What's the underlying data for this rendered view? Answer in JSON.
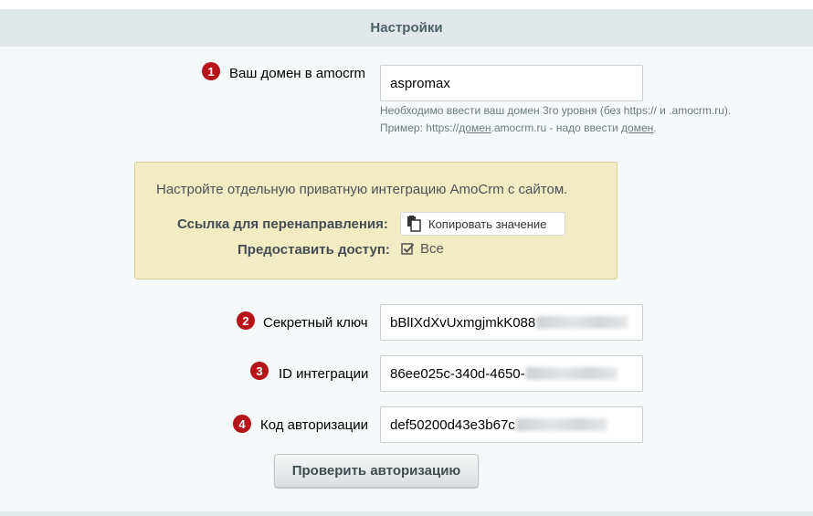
{
  "header": {
    "title": "Настройки"
  },
  "domain": {
    "badge": "1",
    "label": "Ваш домен в amocrm",
    "value": "aspromax",
    "hint_line1": "Необходимо ввести ваш домен 3го уровня (без https:// и .amocrm.ru).",
    "hint_line2_prefix": "Пример: https://",
    "hint_line2_domain": "домен",
    "hint_line2_middle": ".amocrm.ru - надо ввести ",
    "hint_line2_domain2": "домен",
    "hint_line2_suffix": "."
  },
  "notice": {
    "text": "Настройте отдельную приватную интеграцию AmoCrm с сайтом.",
    "redirect_label": "Ссылка для перенаправления:",
    "copy_button": "Копировать значение",
    "access_label": "Предоставить доступ:",
    "access_value": "Все"
  },
  "secret": {
    "badge": "2",
    "label": "Секретный ключ",
    "value": "bBlIXdXvUxmgjmkK088"
  },
  "integration_id": {
    "badge": "3",
    "label": "ID интеграции",
    "value": "86ee025c-340d-4650-"
  },
  "auth_code": {
    "badge": "4",
    "label": "Код авторизации",
    "value": "def50200d43e3b67c"
  },
  "verify_button": "Проверить авторизацию",
  "colors": {
    "badge": "#b5141a",
    "header_bg": "#e0e8ea",
    "notice_bg": "#f2ecc5"
  }
}
